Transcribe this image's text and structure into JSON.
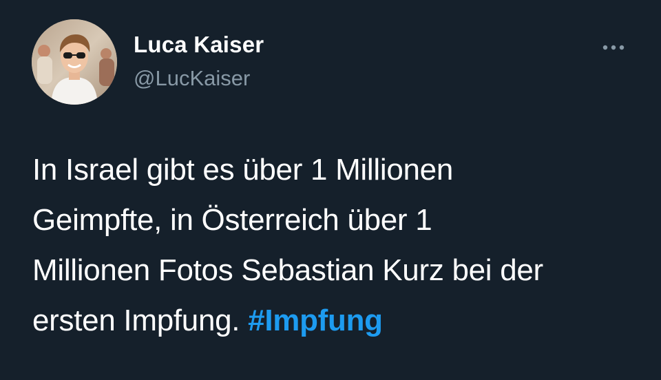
{
  "tweet": {
    "author": {
      "display_name": "Luca Kaiser",
      "handle": "@LucKaiser"
    },
    "more_icon": "ellipsis-icon",
    "text_lines": [
      "In Israel gibt es über 1 Millionen",
      "Geimpfte, in Österreich über 1",
      "Millionen Fotos Sebastian Kurz bei der",
      "ersten Impfung. "
    ],
    "hashtag": "#Impfung"
  },
  "colors": {
    "background": "#15202b",
    "text": "#ffffff",
    "secondary_text": "#8899a6",
    "accent": "#1d9bf0"
  }
}
